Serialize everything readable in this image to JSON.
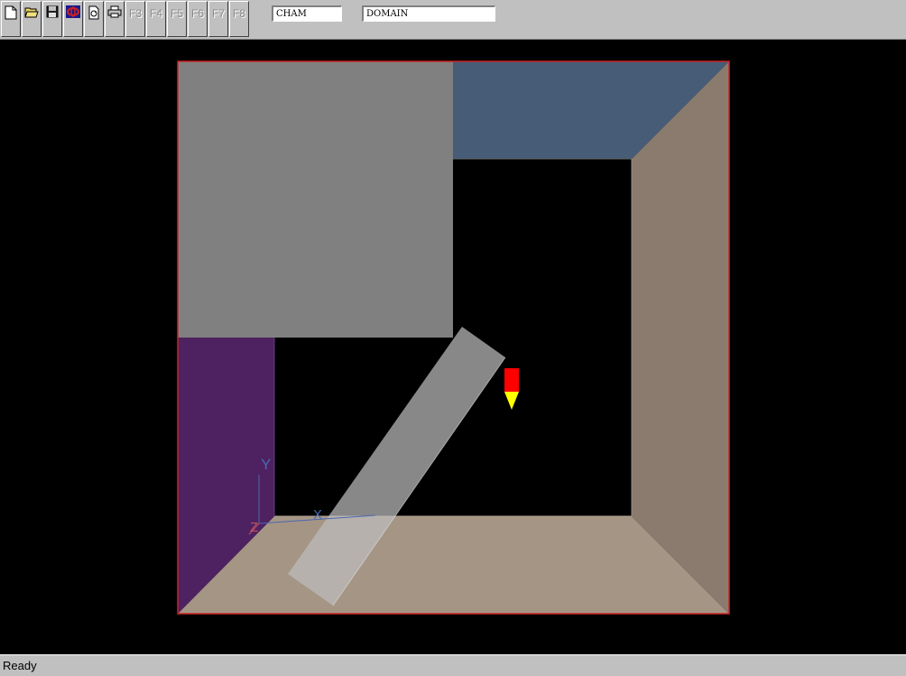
{
  "toolbar": {
    "buttons": [
      {
        "name": "new-file-icon"
      },
      {
        "name": "open-folder-icon"
      },
      {
        "name": "save-disk-icon"
      },
      {
        "name": "chemical-icon"
      },
      {
        "name": "document-refresh-icon"
      },
      {
        "name": "printer-icon"
      }
    ],
    "function_keys": [
      "F3",
      "F4",
      "F5",
      "F6",
      "F7",
      "F8"
    ],
    "field_1": "CHAM",
    "field_2": "DOMAIN"
  },
  "viewport": {
    "background": "#000000",
    "domain_border_color": "#cc2222",
    "walls": {
      "back": "#808080",
      "top": "#465c77",
      "right": "#8a7b6e",
      "bottom": "#a59585",
      "left": "#4e2260"
    },
    "axis_labels": {
      "y": "Y",
      "z": "Z",
      "x": "X"
    },
    "probe_colors": {
      "body": "#ff0000",
      "tip": "#ffff00"
    }
  },
  "status": {
    "text": "Ready"
  }
}
